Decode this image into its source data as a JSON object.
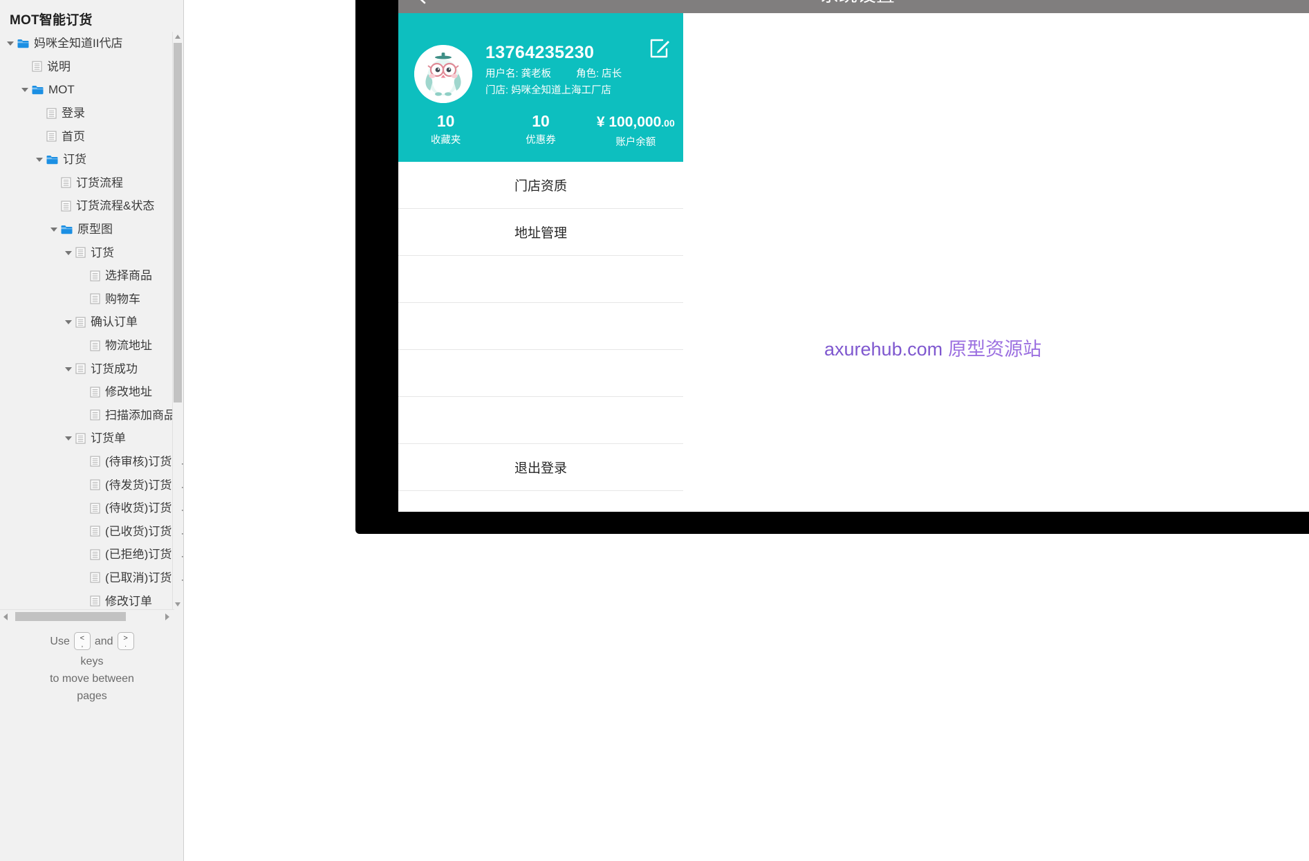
{
  "sidebar": {
    "title": "MOT智能订货",
    "tree": [
      {
        "label": "妈咪全知道II代店",
        "depth": 0,
        "icon": "folder-icon",
        "arrow": "open"
      },
      {
        "label": "说明",
        "depth": 1,
        "icon": "page-icon",
        "arrow": "none"
      },
      {
        "label": "MOT",
        "depth": 1,
        "icon": "folder-icon",
        "arrow": "open"
      },
      {
        "label": "登录",
        "depth": 2,
        "icon": "page-icon",
        "arrow": "none"
      },
      {
        "label": "首页",
        "depth": 2,
        "icon": "page-icon",
        "arrow": "none"
      },
      {
        "label": "订货",
        "depth": 2,
        "icon": "folder-icon",
        "arrow": "open"
      },
      {
        "label": "订货流程",
        "depth": 3,
        "icon": "page-icon",
        "arrow": "none"
      },
      {
        "label": "订货流程&状态",
        "depth": 3,
        "icon": "page-icon",
        "arrow": "none"
      },
      {
        "label": "原型图",
        "depth": 3,
        "icon": "folder-icon",
        "arrow": "open"
      },
      {
        "label": "订货",
        "depth": 4,
        "icon": "page-icon",
        "arrow": "open"
      },
      {
        "label": "选择商品",
        "depth": 5,
        "icon": "page-icon",
        "arrow": "none"
      },
      {
        "label": "购物车",
        "depth": 5,
        "icon": "page-icon",
        "arrow": "none"
      },
      {
        "label": "确认订单",
        "depth": 4,
        "icon": "page-icon",
        "arrow": "open"
      },
      {
        "label": "物流地址",
        "depth": 5,
        "icon": "page-icon",
        "arrow": "none"
      },
      {
        "label": "订货成功",
        "depth": 4,
        "icon": "page-icon",
        "arrow": "open"
      },
      {
        "label": "修改地址",
        "depth": 5,
        "icon": "page-icon",
        "arrow": "none"
      },
      {
        "label": "扫描添加商品",
        "depth": 5,
        "icon": "page-icon",
        "arrow": "none"
      },
      {
        "label": "订货单",
        "depth": 4,
        "icon": "page-icon",
        "arrow": "open"
      },
      {
        "label": "(待审核)订货单",
        "depth": 5,
        "icon": "page-icon",
        "arrow": "none"
      },
      {
        "label": "(待发货)订货单",
        "depth": 5,
        "icon": "page-icon",
        "arrow": "none"
      },
      {
        "label": "(待收货)订货单",
        "depth": 5,
        "icon": "page-icon",
        "arrow": "none"
      },
      {
        "label": "(已收货)订货单",
        "depth": 5,
        "icon": "page-icon",
        "arrow": "none"
      },
      {
        "label": "(已拒绝)订货单",
        "depth": 5,
        "icon": "page-icon",
        "arrow": "none"
      },
      {
        "label": "(已取消)订货单",
        "depth": 5,
        "icon": "page-icon",
        "arrow": "none"
      },
      {
        "label": "修改订单",
        "depth": 5,
        "icon": "page-icon",
        "arrow": "none"
      }
    ],
    "hint": {
      "use": "Use",
      "key_prev_top": "<",
      "key_prev_bottom": ",",
      "and": "and",
      "key_next_top": ">",
      "key_next_bottom": ".",
      "keys": "keys",
      "line3": "to move between",
      "line4": "pages"
    }
  },
  "phone": {
    "navbar": {
      "title": "系统设置",
      "back_icon": "back-chevron-icon"
    },
    "profile": {
      "phone": "13764235230",
      "username_label": "用户名:",
      "username_value": "龚老板",
      "role_label": "角色:",
      "role_value": "店长",
      "store_label": "门店:",
      "store_value": "妈咪全知道上海工厂店",
      "edit_icon": "edit-pencil-icon",
      "avatar_icon": "penguin-avatar-icon",
      "stats": [
        {
          "value": "10",
          "label": "收藏夹"
        },
        {
          "value": "10",
          "label": "优惠券"
        },
        {
          "value": "¥ 100,000",
          "cents": ".00",
          "label": "账户余额"
        }
      ]
    },
    "menu": [
      {
        "label": "门店资质",
        "blank": false
      },
      {
        "label": "地址管理",
        "blank": false
      },
      {
        "label": "",
        "blank": true
      },
      {
        "label": "",
        "blank": true
      },
      {
        "label": "",
        "blank": true
      },
      {
        "label": "",
        "blank": true
      },
      {
        "label": "退出登录",
        "blank": false
      }
    ]
  },
  "watermark": {
    "site": "axurehub.com",
    "cn": "原型资源站"
  },
  "colors": {
    "accent_teal": "#0dbfbf",
    "navbar_gray": "#807e7e",
    "sidebar_bg": "#f1f1f1",
    "folder_blue": "#1b8fe3",
    "watermark_purple": "#8a5fd6"
  }
}
